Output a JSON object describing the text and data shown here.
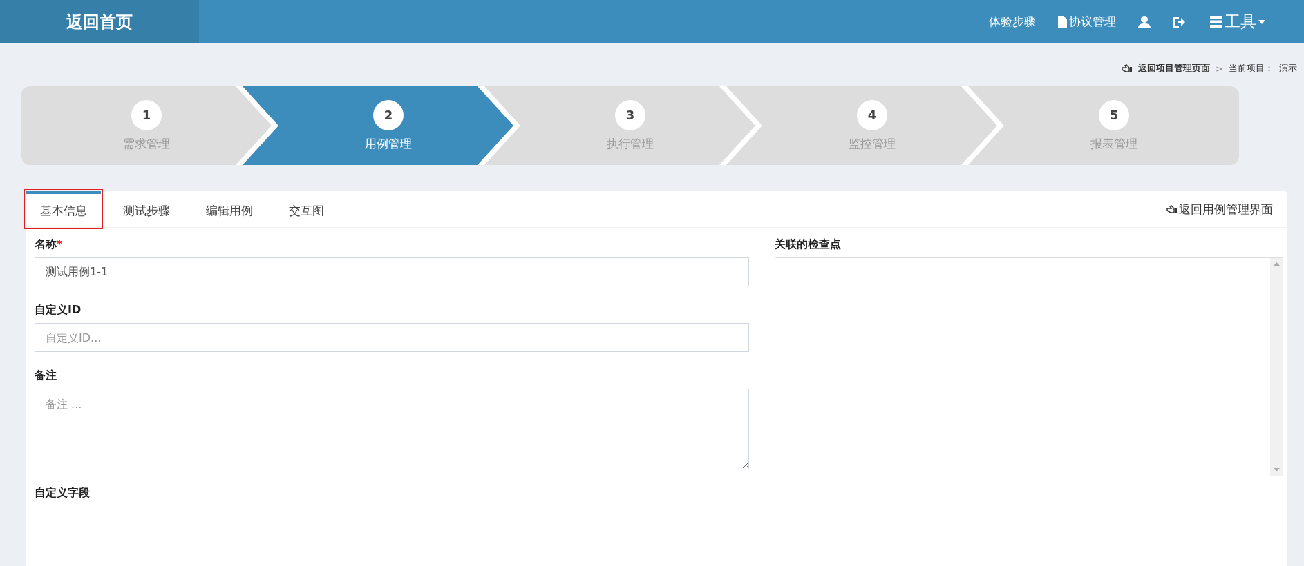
{
  "header": {
    "home": "返回首页",
    "nav": [
      {
        "kind": "text",
        "label": "体验步骤"
      },
      {
        "kind": "document",
        "label": "协议管理"
      },
      {
        "kind": "user"
      },
      {
        "kind": "logout"
      },
      {
        "kind": "menu",
        "label": "工具"
      }
    ]
  },
  "breadcrumb": {
    "back": "返回项目管理页面",
    "separator": ">",
    "current_label": "当前项目：",
    "current_value": "演示"
  },
  "steps": [
    {
      "number": "1",
      "label": "需求管理",
      "selected": false
    },
    {
      "number": "2",
      "label": "用例管理",
      "selected": true
    },
    {
      "number": "3",
      "label": "执行管理",
      "selected": false
    },
    {
      "number": "4",
      "label": "监控管理",
      "selected": false
    },
    {
      "number": "5",
      "label": "报表管理",
      "selected": false
    }
  ],
  "tabs": [
    {
      "label": "基本信息",
      "selected": true
    },
    {
      "label": "测试步骤",
      "selected": false
    },
    {
      "label": "编辑用例",
      "selected": false
    },
    {
      "label": "交互图",
      "selected": false
    }
  ],
  "back_link": "返回用例管理界面",
  "form": {
    "name": {
      "label": "名称",
      "required_mark": "*",
      "value": "测试用例1-1"
    },
    "custom_id": {
      "label": "自定义ID",
      "placeholder": "自定义ID..."
    },
    "remark": {
      "label": "备注",
      "placeholder": "备注 ..."
    },
    "custom_fields": {
      "label": "自定义字段"
    }
  },
  "checkpoints": {
    "label": "关联的检查点"
  }
}
